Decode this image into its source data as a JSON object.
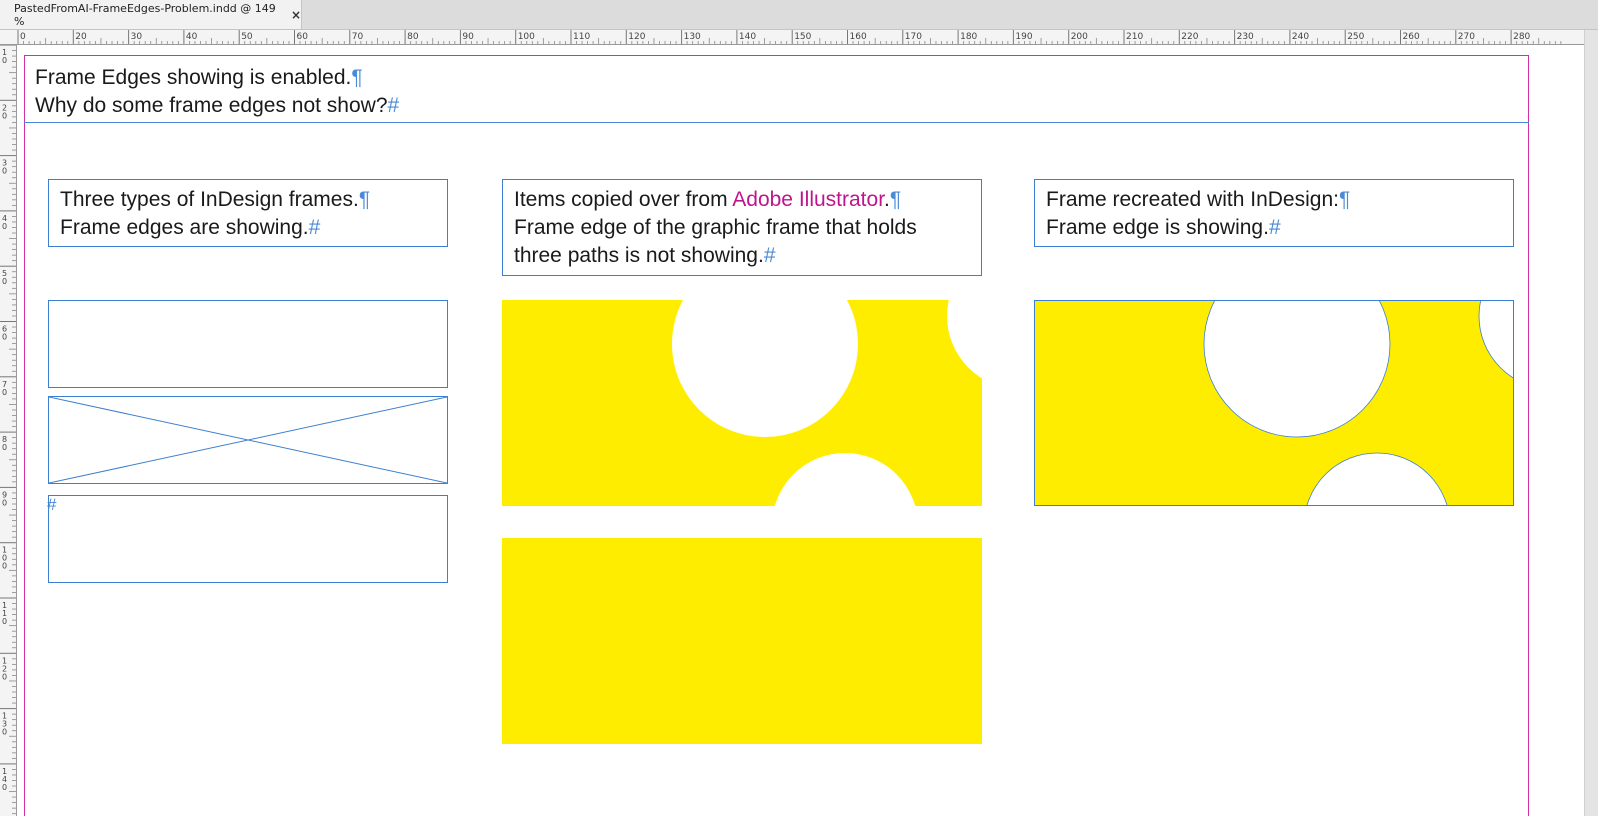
{
  "app": {
    "tab": {
      "title": "PastedFromAI-FrameEdges-Problem.indd @ 149 %",
      "close_label": "×"
    },
    "ruler": {
      "horizontal_labels": [
        "0",
        "20",
        "30",
        "40",
        "50",
        "60",
        "70",
        "80",
        "90",
        "100",
        "110",
        "120",
        "130",
        "140",
        "150",
        "160",
        "170",
        "180",
        "190",
        "200",
        "210",
        "220",
        "230",
        "240",
        "250",
        "260",
        "270",
        "280"
      ],
      "vertical_labels": [
        "10",
        "20",
        "30",
        "40",
        "50",
        "60",
        "70",
        "80",
        "90",
        "100",
        "110",
        "120",
        "130",
        "140"
      ]
    }
  },
  "colors": {
    "frame_edge": "#3c7fd0",
    "margin_guide": "#d22fa8",
    "yellow_fill": "#ffed00",
    "illustrator_text": "#c0148c",
    "hidden_char": "#4a8ad6"
  },
  "header": {
    "line1": "Frame Edges showing is enabled.",
    "line1_mark": "¶",
    "line2": "Why do some frame edges not show?",
    "line2_mark": "#"
  },
  "columns": {
    "left": {
      "line1": "Three types of InDesign frames.",
      "line1_mark": "¶",
      "line2": "Frame edges are showing.",
      "line2_mark": "#",
      "text_frame_mark": "#"
    },
    "middle": {
      "line1_prefix": "Items copied over from ",
      "line1_accent": "Adobe Illustrator",
      "line1_suffix": ".",
      "line1_mark": "¶",
      "line2": "Frame edge of the graphic frame that holds",
      "line3": "three paths is not showing.",
      "line3_mark": "#"
    },
    "right": {
      "line1": "Frame recreated with InDesign:",
      "line1_mark": "¶",
      "line2": "Frame edge is showing.",
      "line2_mark": "#"
    }
  },
  "icons": {
    "close": "close-icon",
    "placeholder": "graphic-frame-placeholder-x-icon"
  }
}
